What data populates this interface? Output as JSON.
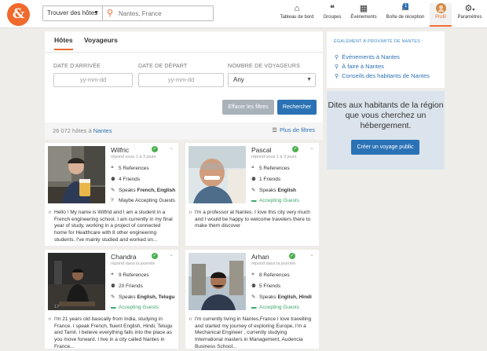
{
  "header": {
    "search_type": "Trouver des hôtes",
    "search_placeholder": "Nantes, France",
    "nav": [
      {
        "label": "Tableau de bord",
        "icon": "home-icon"
      },
      {
        "label": "Groupes",
        "icon": "chat-bubbles-icon"
      },
      {
        "label": "Événements",
        "icon": "calendar-icon"
      },
      {
        "label": "Boîte de réception",
        "icon": "inbox-icon",
        "badge": "1"
      },
      {
        "label": "Profil",
        "icon": "avatar"
      },
      {
        "label": "Paramètres",
        "icon": "gear-icon"
      }
    ]
  },
  "filters": {
    "tabs": [
      "Hôtes",
      "Voyageurs"
    ],
    "arrival_label": "DATE D'ARRIVÉE",
    "arrival_placeholder": "yy-mm-dd",
    "departure_label": "DATE DE DÉPART",
    "departure_placeholder": "yy-mm-dd",
    "travelers_label": "NOMBRE DE VOYAGEURS",
    "travelers_value": "Any",
    "clear_label": "Effacer les filtres",
    "search_label": "Rechercher"
  },
  "results": {
    "count_text": "26 072 hôtes à ",
    "location": "Nantes",
    "more_filters": "Plus de filtres"
  },
  "hosts": [
    {
      "name": "Wilfric",
      "response": "répond sous 1 à 3 jours",
      "references": "5 References",
      "friends": "4 Friends",
      "speaks_prefix": "Speaks ",
      "languages": "French, English",
      "status": "Maybe Accepting Guests",
      "about": "Hello ! My name is Wilfrid and I am a student in a French engineering school. I am currently in my final year of study, working in a project of connected home for Healthcare with 8 other engineering students. I've mainly studied and worked on..."
    },
    {
      "name": "Pascal",
      "response": "répond sous 1 à 3 jours",
      "references": "5 References",
      "friends": "1 Friends",
      "speaks_prefix": "Speaks ",
      "languages": "English",
      "status": "Accepting Guests",
      "about": "I'm a professor at Nantes. I love this city very much and I would be happy to welcome travelers there to make them discover"
    },
    {
      "name": "Chandra",
      "response": "répond dans la journée",
      "references": "9 References",
      "friends": "20 Friends",
      "speaks_prefix": "Speaks ",
      "languages": "English, Telugu",
      "status": "Accepting Guests",
      "about": "I'm 21 years old basically from India, studying in France. I speak French, fluent English, Hindi, Telugu and Tamil. I believe everything falls into the place as you move forward. I live in a city called Nantes in France..."
    },
    {
      "name": "Arhan",
      "response": "répond dans la journée",
      "references": "8 References",
      "friends": "5 Friends",
      "speaks_prefix": "Speaks ",
      "languages": "English, Hindi",
      "status": "Accepting Guests",
      "about": "I'm currently living in Nantes,France I love travelling and started my journey of exploring Europe, I'm a Mechanical Engineer , currently studying International masters in Management, Audencia Business School..."
    }
  ],
  "sidebar": {
    "heading": "ÉGALEMENT À PROXIMITÉ DE NANTES :",
    "links": [
      "Événements à Nantes",
      "À faire à Nantes",
      "Conseils des habitants de Nantes"
    ],
    "promo_text": "Dites aux habitants de la région que vous cherchez un hébergement.",
    "promo_button": "Créer un voyage public"
  }
}
